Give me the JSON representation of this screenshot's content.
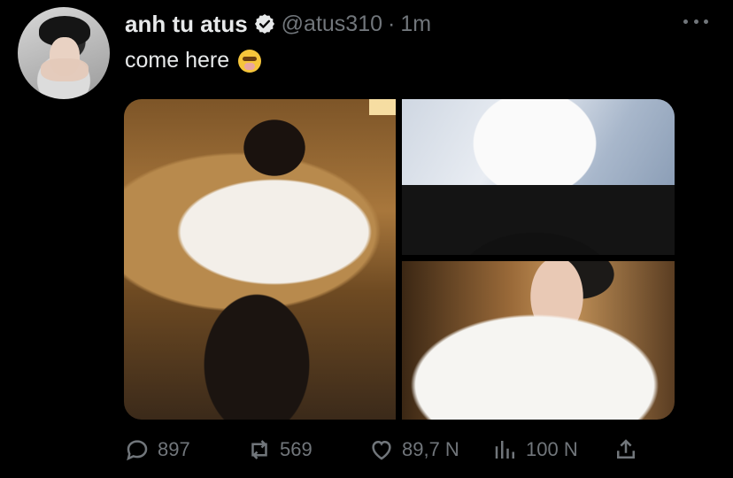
{
  "tweet": {
    "author_name": "anh tu atus",
    "handle": "@atus310",
    "separator": "·",
    "time": "1m",
    "text": "come here",
    "emoji": "face-with-open-eyes-and-hand-over-mouth-emoji"
  },
  "media": [
    {
      "name": "photo-1",
      "description_icon": "image"
    },
    {
      "name": "photo-2",
      "description_icon": "image"
    },
    {
      "name": "photo-3",
      "description_icon": "image"
    }
  ],
  "actions": {
    "replies": "897",
    "retweets": "569",
    "likes": "89,7 N",
    "views": "100 N"
  },
  "colors": {
    "background": "#000000",
    "text": "#e7e9ea",
    "muted": "#71767b"
  }
}
